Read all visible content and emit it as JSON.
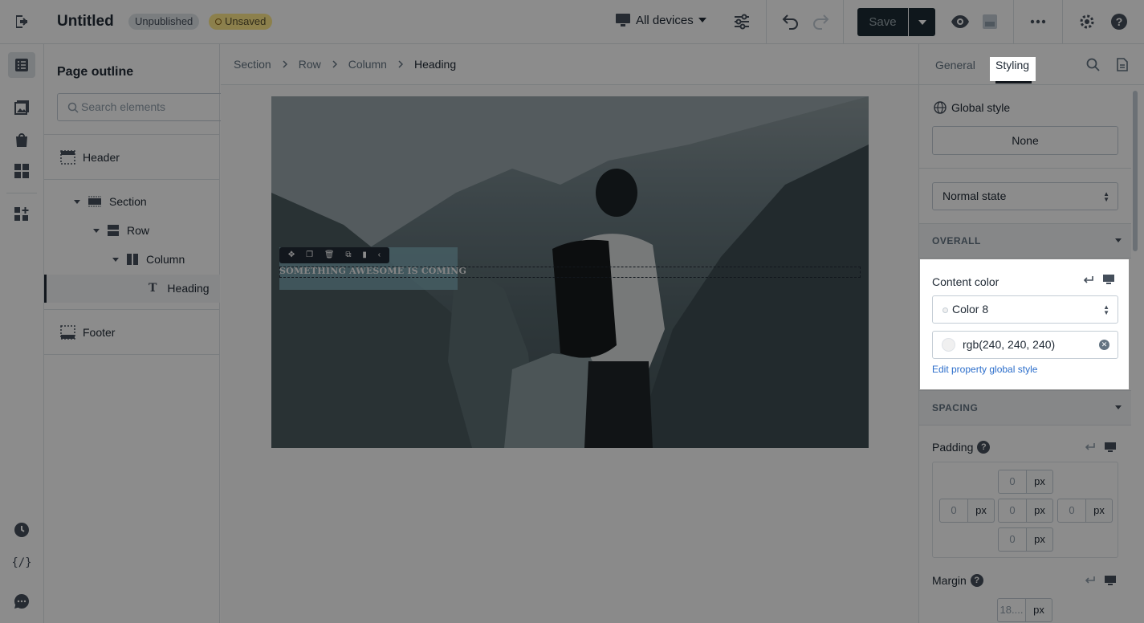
{
  "header": {
    "title": "Untitled",
    "badges": {
      "unpublished": "Unpublished",
      "unsaved": "Unsaved"
    },
    "device_select": "All devices",
    "save_label": "Save"
  },
  "outline": {
    "title": "Page outline",
    "search_placeholder": "Search elements",
    "items": [
      "Header",
      "Section",
      "Row",
      "Column",
      "Heading",
      "Footer"
    ]
  },
  "breadcrumb": [
    "Section",
    "Row",
    "Column",
    "Heading"
  ],
  "canvas": {
    "heading_text": "SOMETHING AWESOME IS COMING"
  },
  "right_panel": {
    "tabs": [
      "General",
      "Styling"
    ],
    "active_tab": "Styling",
    "global_style_label": "Global style",
    "global_style_value": "None",
    "state_select": "Normal state",
    "overall_header": "OVERALL",
    "content_color_label": "Content color",
    "color_select": "Color 8",
    "color_value": "rgb(240, 240, 240)",
    "edit_link": "Edit property global style",
    "spacing_header": "SPACING",
    "padding_label": "Padding",
    "margin_label": "Margin",
    "padding": {
      "top": "0",
      "left": "0",
      "center": "0",
      "right": "0",
      "bottom": "0"
    },
    "padding_unit": "px",
    "margin_top": "18....",
    "margin_unit": "px"
  },
  "colors": {
    "accent_dark": "#212b36",
    "link": "#2c6ecb",
    "badge_yellow": "#ffea8a",
    "save_bg": "#1c2b33"
  }
}
